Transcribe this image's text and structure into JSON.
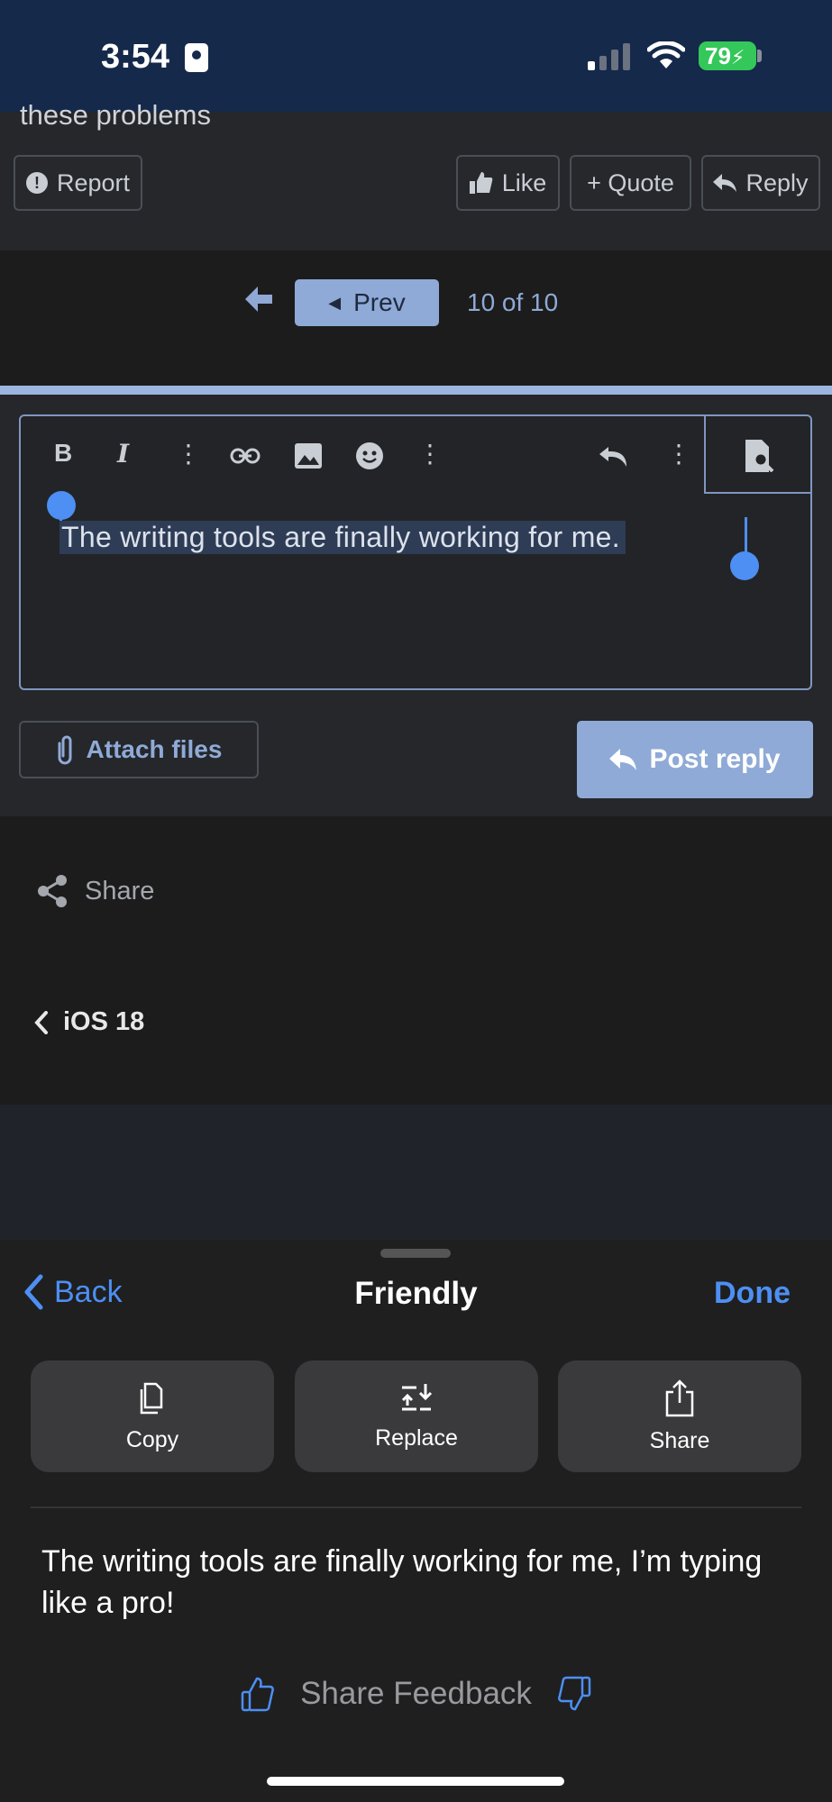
{
  "status_bar": {
    "time": "3:54",
    "battery": "79"
  },
  "post": {
    "tail_text": "these problems",
    "report_label": "Report",
    "like_label": "Like",
    "quote_label": "+ Quote",
    "reply_label": "Reply"
  },
  "pager": {
    "prev_label": "Prev",
    "page_count": "10 of 10"
  },
  "editor": {
    "text": "The writing tools are finally working for me.",
    "attach_label": "Attach files",
    "post_reply_label": "Post reply"
  },
  "thread": {
    "share_label": "Share",
    "breadcrumb": "iOS 18"
  },
  "writing_tools": {
    "back_label": "Back",
    "title": "Friendly",
    "done_label": "Done",
    "actions": [
      {
        "label": "Copy"
      },
      {
        "label": "Replace"
      },
      {
        "label": "Share"
      }
    ],
    "result": "The writing tools are finally working for me, I’m typing like a pro!",
    "feedback_label": "Share Feedback"
  },
  "colors": {
    "accent": "#8faad6",
    "ios_blue": "#4d8ff2",
    "battery_green": "#34c759"
  }
}
